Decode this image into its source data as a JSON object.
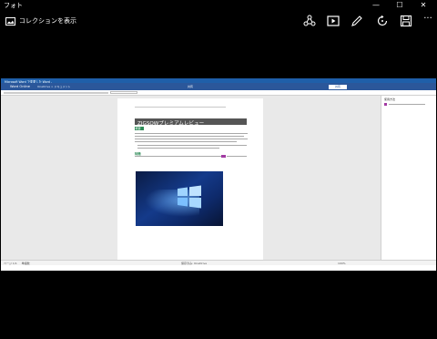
{
  "window": {
    "title": "フォト",
    "minimize": "—",
    "maximize": "☐",
    "close": "✕"
  },
  "toolbar": {
    "collection_label": "コレクションを表示",
    "more": "···"
  },
  "photo": {
    "browser_tab": "Microsoft Word で変更した Word - ",
    "office_app": "Word Online",
    "office_doc": "OneDrive > ドキュメント",
    "office_center": "共有",
    "office_button": "共有",
    "task_pane_title": "使用方法",
    "heading": "ZIGSOWプレミアムレビュー",
    "label_1": "概要",
    "label_2": "特徴",
    "status_left": "ページ 1/1 　 単語数",
    "status_center": "保存済み: OneDrive",
    "status_right": "100%"
  },
  "colors": {
    "office_blue": "#2b579a",
    "browser_blue": "#1f5fa9",
    "heading_gray": "#555555",
    "label_green": "#2e8b57"
  }
}
